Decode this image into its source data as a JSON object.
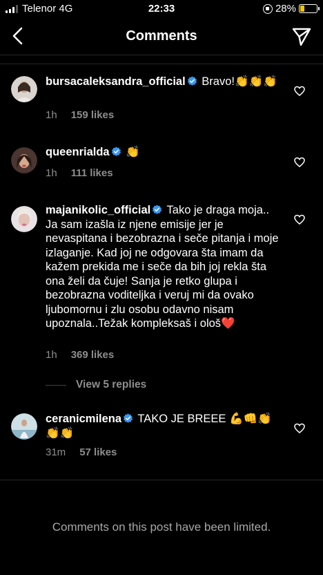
{
  "status_bar": {
    "carrier": "Telenor 4G",
    "time": "22:33",
    "battery": "28%",
    "battery_level": 0.28
  },
  "header": {
    "title": "Comments",
    "back_icon": "chevron-left-icon",
    "send_icon": "paper-plane-icon"
  },
  "comments": [
    {
      "username": "bursacaleksandra_official",
      "verified": true,
      "text": "Bravo!👏👏👏",
      "time": "1h",
      "likes": "159 likes"
    },
    {
      "username": "queenrialda",
      "verified": true,
      "text": "👏",
      "time": "1h",
      "likes": "111 likes"
    },
    {
      "username": "majanikolic_official",
      "verified": true,
      "text": "Tako je draga moja.. Ja sam izašla iz njene emisije jer je nevaspitana i bezobrazna i seče pitanja i moje izlaganje. Kad joj ne odgovara šta imam da kažem prekida me i seče da bih joj rekla šta ona želi da čuje! Sanja je retko glupa i bezobrazna voditeljka i veruj mi da ovako ljubomornu i zlu osobu odavno nisam upoznala..Težak kompleksaš i ološ❤️",
      "time": "1h",
      "likes": "369 likes",
      "view_replies": "View 5 replies"
    },
    {
      "username": "ceranicmilena",
      "verified": true,
      "text": "TAKO JE BREEE 💪👊👏👏👏",
      "time": "31m",
      "likes": "57 likes"
    }
  ],
  "footer": {
    "limited_text": "Comments on this post have been limited."
  },
  "colors": {
    "background": "#000000",
    "verified_blue": "#3897f0",
    "muted": "#8e8e8e"
  }
}
